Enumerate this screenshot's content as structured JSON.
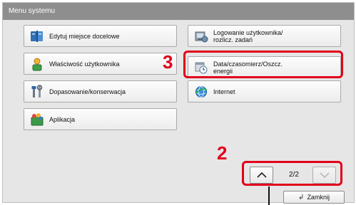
{
  "window": {
    "title": "Menu systemu"
  },
  "menu": {
    "items": [
      {
        "label": "Edytuj miejsce docelowe",
        "icon": "address-book-icon"
      },
      {
        "label": "Logowanie użytkownika/\nrozlicz. zadań",
        "icon": "user-login-accounting-icon"
      },
      {
        "label": "Właściwość użytkownika",
        "icon": "user-property-icon"
      },
      {
        "label": "Data/czasomierz/Oszcz.\nenergii",
        "icon": "date-timer-energy-icon"
      },
      {
        "label": "Dopasowanie/konserwacja",
        "icon": "adjustment-tools-icon"
      },
      {
        "label": "Internet",
        "icon": "globe-icon"
      },
      {
        "label": "Aplikacja",
        "icon": "application-icon"
      }
    ]
  },
  "pager": {
    "indicator": "2/2"
  },
  "footer": {
    "close_label": "Zamknij"
  },
  "callouts": {
    "step_date": "3",
    "step_pager": "2"
  },
  "colors": {
    "highlight": "#e2001a",
    "titlebar": "#8e8e8e",
    "panel": "#e6e6e6"
  }
}
